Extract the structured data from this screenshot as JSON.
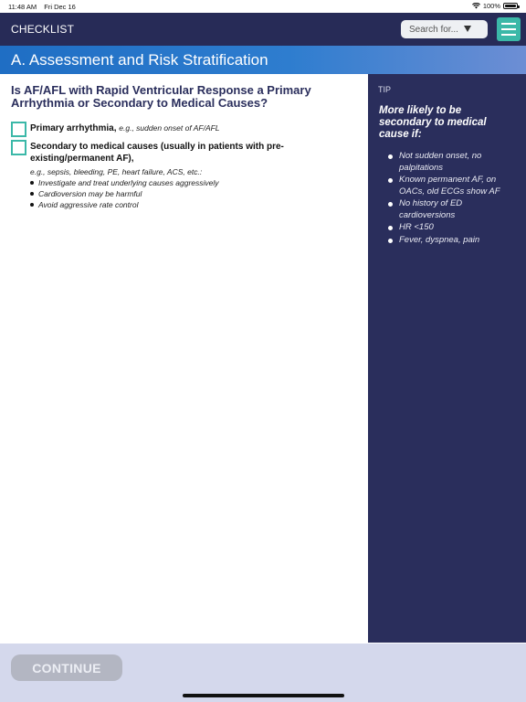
{
  "status_bar": {
    "time": "11:48 AM",
    "date": "Fri Dec 16",
    "battery": "100%"
  },
  "header": {
    "title": "CHECKLIST",
    "search_placeholder": "Search for..."
  },
  "section": {
    "title": "A. Assessment and Risk Stratification"
  },
  "main": {
    "question": "Is AF/AFL with Rapid Ventricular Response a Primary Arrhythmia or Secondary to Medical Causes?",
    "options": [
      {
        "label": "Primary arrhythmia,",
        "example": "e.g., sudden onset of AF/AFL"
      },
      {
        "label": "Secondary to medical causes (usually in patients with pre-existing/permanent AF),"
      }
    ],
    "secondary_example": "e.g., sepsis, bleeding, PE, heart failure, ACS, etc.:",
    "secondary_bullets": [
      "Investigate and treat underlying causes aggressively",
      "Cardioversion may be harmful",
      "Avoid aggressive rate control"
    ]
  },
  "tip": {
    "label": "TIP",
    "heading": "More likely to be secondary to medical cause if:",
    "items": [
      "Not sudden onset, no palpitations",
      "Known permanent AF, on OACs, old ECGs show AF",
      "No history of ED cardioversions",
      "HR <150",
      "Fever, dyspnea, pain"
    ]
  },
  "footer": {
    "continue_label": "CONTINUE"
  },
  "colors": {
    "header_bg": "#272b57",
    "accent": "#3bb8a8",
    "banner_blue": "#1f6ec4",
    "tip_bg": "#2a2e5c",
    "footer_bg": "#d4d8ec"
  }
}
